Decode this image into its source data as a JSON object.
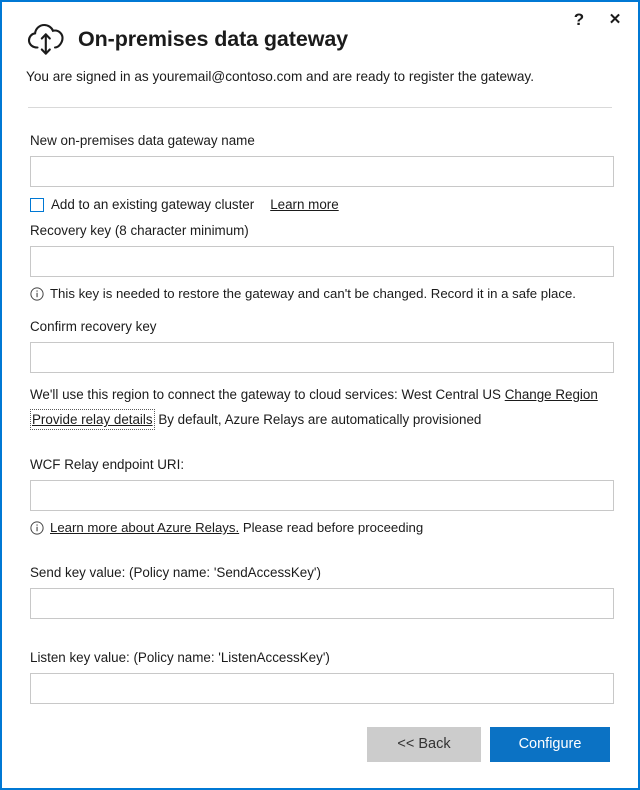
{
  "window": {
    "border_color": "#0078d4",
    "help_label": "?",
    "close_label": "✕"
  },
  "header": {
    "icon": "cloud-upload-download-icon",
    "title": "On-premises data gateway",
    "signed_in_text": "You are signed in as youremail@contoso.com and are ready to register the gateway."
  },
  "form": {
    "gateway_name": {
      "label": "New on-premises data gateway name",
      "value": "",
      "placeholder": ""
    },
    "cluster_checkbox": {
      "label": "Add to an existing gateway cluster",
      "checked": false,
      "learn_more": "Learn more"
    },
    "recovery_key": {
      "label": "Recovery key (8 character minimum)",
      "value": "",
      "placeholder": "",
      "info": "This key is needed to restore the gateway and can't be changed. Record it in a safe place.",
      "info_icon": "info-circle-icon"
    },
    "confirm_recovery_key": {
      "label": "Confirm recovery key",
      "value": "",
      "placeholder": ""
    },
    "region_note": {
      "text": "We'll use this region to connect the gateway to cloud services: West Central US",
      "region": "West Central US",
      "change_link": "Change Region"
    },
    "relay_note": {
      "link": "Provide relay details",
      "text": "By default, Azure Relays are automatically provisioned"
    },
    "wcf_relay_uri": {
      "label": "WCF Relay endpoint URI:",
      "value": "",
      "placeholder": "",
      "info_icon": "info-circle-icon",
      "info_link": "Learn more about Azure Relays.",
      "info_text": "Please read before proceeding"
    },
    "send_key": {
      "label": "Send key value: (Policy name: 'SendAccessKey')",
      "value": "",
      "placeholder": ""
    },
    "listen_key": {
      "label": "Listen key value: (Policy name: 'ListenAccessKey')",
      "value": "",
      "placeholder": ""
    }
  },
  "footer": {
    "back_label": "<< Back",
    "configure_label": "Configure",
    "primary_color": "#0b72c4",
    "secondary_color": "#cccccc"
  }
}
